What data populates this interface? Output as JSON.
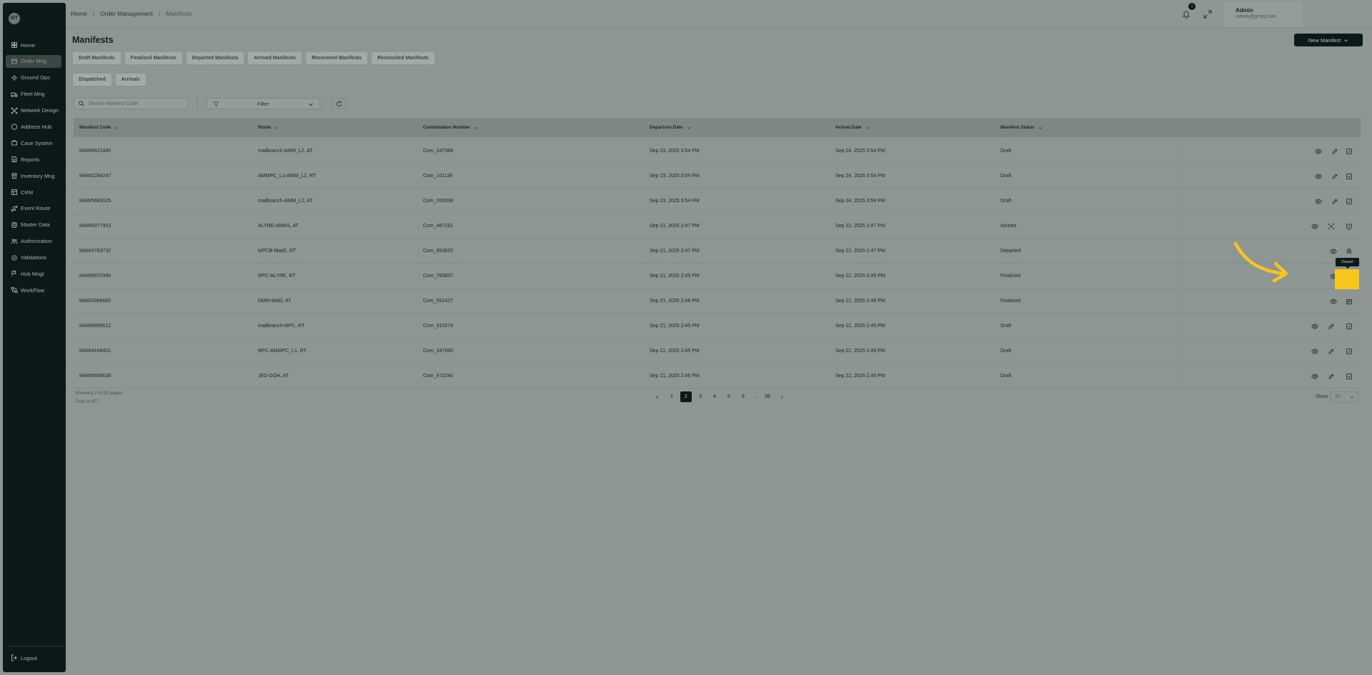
{
  "sidebar": {
    "logo_text": "GT",
    "items": [
      {
        "label": "Home",
        "icon": "home-icon"
      },
      {
        "label": "Order Mng",
        "icon": "orders-icon"
      },
      {
        "label": "Ground Ops",
        "icon": "ground-ops-icon"
      },
      {
        "label": "Fleet Mng",
        "icon": "truck-icon"
      },
      {
        "label": "Network Design",
        "icon": "network-icon"
      },
      {
        "label": "Address Hub",
        "icon": "address-icon"
      },
      {
        "label": "Case System",
        "icon": "case-icon"
      },
      {
        "label": "Reports",
        "icon": "reports-icon"
      },
      {
        "label": "Inventory Mng",
        "icon": "inventory-icon"
      },
      {
        "label": "CRM",
        "icon": "crm-icon"
      },
      {
        "label": "Event Route",
        "icon": "route-icon"
      },
      {
        "label": "Master Data",
        "icon": "database-icon"
      },
      {
        "label": "Authorization",
        "icon": "users-icon"
      },
      {
        "label": "Validations",
        "icon": "validations-icon"
      },
      {
        "label": "Hub Mngt",
        "icon": "hub-icon"
      },
      {
        "label": "WorkFlow",
        "icon": "workflow-icon"
      }
    ],
    "active_index": 1,
    "logout_label": "Logout"
  },
  "header": {
    "breadcrumb": [
      "Home",
      "Order Management",
      "Manifests"
    ],
    "notification_count": "1",
    "user_name": "Admin",
    "user_email": "admin@gmtq.com"
  },
  "page": {
    "title": "Manifests",
    "new_button_label": "New Manifest",
    "tabs_row1": [
      "Draft Manifests",
      "Finalized Manifests",
      "Departed Manifests",
      "Arrived Manifests",
      "Recovered Manifests",
      "Reconciled Manifests"
    ],
    "tabs_row2": [
      "Dispatched",
      "Arrivals"
    ],
    "search_placeholder": "Search Manifest Code",
    "filter_label": "Filter"
  },
  "table": {
    "columns": [
      "Manifest Code",
      "Route",
      "Combination Number",
      "Departure Date",
      "Arrival Date",
      "Manifest Status"
    ],
    "rows": [
      {
        "code": "MAW6821485",
        "route": "mailbranch-AMM_L2, AT",
        "combo": "Com_247388",
        "dep": "Sep 23, 2025 3:54 PM",
        "arr": "Sep 24, 2025 3:54 PM",
        "status": "Draft",
        "actions": [
          "view",
          "edit",
          "finalize"
        ]
      },
      {
        "code": "MAW2284247",
        "route": "AMMPC_L1-AMM_L2, RT",
        "combo": "Com_101136",
        "dep": "Sep 23, 2025 3:54 PM",
        "arr": "Sep 24, 2025 3:54 PM",
        "status": "Draft",
        "actions": [
          "view",
          "edit",
          "finalize"
        ]
      },
      {
        "code": "MAW5683025",
        "route": "mailbranch-AMM_L2, AT",
        "combo": "Com_200938",
        "dep": "Sep 23, 2025 3:54 PM",
        "arr": "Sep 24, 2025 3:54 PM",
        "status": "Draft",
        "actions": [
          "view",
          "edit",
          "finalize"
        ]
      },
      {
        "code": "MAW6077953",
        "route": "ALYRE-AMM1, AT",
        "combo": "Com_487162",
        "dep": "Sep 21, 2025 2:47 PM",
        "arr": "Sep 22, 2025 2:47 PM",
        "status": "Arrived",
        "actions": [
          "view",
          "scan",
          "recover"
        ]
      },
      {
        "code": "MAW4783732",
        "route": "MPCB-Mad2, RT",
        "combo": "Com_853620",
        "dep": "Sep 21, 2025 2:47 PM",
        "arr": "Sep 22, 2025 2:47 PM",
        "status": "Departed",
        "actions": [
          "view",
          "arrive"
        ]
      },
      {
        "code": "MAW6970386",
        "route": "RPC-ALYRE, RT",
        "combo": "Com_763837",
        "dep": "Sep 21, 2025 2:45 PM",
        "arr": "Sep 22, 2025 2:45 PM",
        "status": "Finalized",
        "actions": [
          "view",
          "depart"
        ]
      },
      {
        "code": "MAW2066682",
        "route": "DMM-MAD, AT",
        "combo": "Com_552427",
        "dep": "Sep 21, 2025 2:46 PM",
        "arr": "Sep 22, 2025 2:46 PM",
        "status": "Finalized",
        "actions": [
          "view",
          "depart"
        ]
      },
      {
        "code": "MAW8495612",
        "route": "mailbranch-MPC, RT",
        "combo": "Com_315576",
        "dep": "Sep 21, 2025 2:45 PM",
        "arr": "Sep 22, 2025 2:45 PM",
        "status": "Draft",
        "actions": [
          "view",
          "edit",
          "finalize"
        ]
      },
      {
        "code": "MAW4168401",
        "route": "RPC-AMMPC_L1, RT",
        "combo": "Com_347660",
        "dep": "Sep 21, 2025 2:45 PM",
        "arr": "Sep 22, 2025 2:45 PM",
        "status": "Draft",
        "actions": [
          "view",
          "edit",
          "finalize"
        ]
      },
      {
        "code": "MAW5654638",
        "route": "JED-DOH, AT",
        "combo": "Com_972240",
        "dep": "Sep 21, 2025 2:46 PM",
        "arr": "Sep 22, 2025 2:46 PM",
        "status": "Draft",
        "actions": [
          "view",
          "edit",
          "finalize"
        ]
      }
    ],
    "tooltip": "Depart"
  },
  "footer": {
    "showing_text": "Showing 2 of 98 pages",
    "total_text": "Total of 977",
    "pages": [
      "1",
      "2",
      "3",
      "4",
      "5",
      "6",
      "...",
      "98"
    ],
    "active_page": "2",
    "show_label": "Show",
    "page_size": "10"
  },
  "colors": {
    "sidebar_bg": "#0b1a18",
    "overlay_bg": "#8e9693",
    "highlight": "#f6c61c",
    "arrow": "#f6c61c"
  }
}
